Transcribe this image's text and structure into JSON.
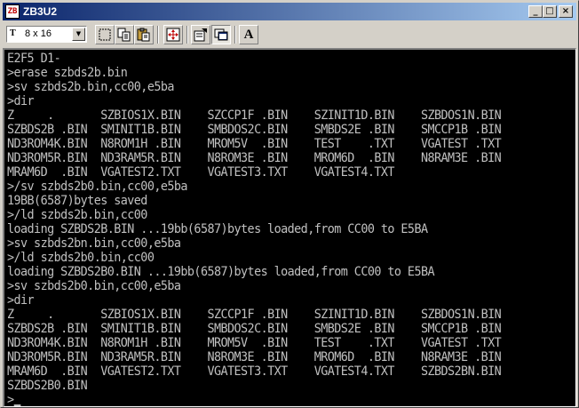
{
  "window": {
    "title": "ZB3U2",
    "icon_text": "ZB",
    "controls": {
      "minimize": "_",
      "maximize": "□",
      "close": "×"
    }
  },
  "toolbar": {
    "font_icon": "T",
    "font_size": "8 x 16",
    "buttons": [
      {
        "name": "select-icon"
      },
      {
        "name": "copy-icon"
      },
      {
        "name": "paste-icon"
      },
      {
        "name": "fullscreen-icon"
      },
      {
        "name": "properties-icon"
      },
      {
        "name": "background-icon"
      },
      {
        "name": "font-icon",
        "label": "A"
      }
    ]
  },
  "console": {
    "lines": [
      "E2F5 D1-",
      ">erase szbds2b.bin",
      ">sv szbds2b.bin,cc00,e5ba",
      ">dir",
      "Z     .       SZBIOS1X.BIN    SZCCP1F .BIN    SZINIT1D.BIN    SZBDOS1N.BIN",
      "SZBDS2B .BIN  SMINIT1B.BIN    SMBDOS2C.BIN    SMBDS2E .BIN    SMCCP1B .BIN",
      "ND3ROM4K.BIN  N8ROM1H .BIN    MROM5V  .BIN    TEST    .TXT    VGATEST .TXT",
      "ND3ROM5R.BIN  ND3RAM5R.BIN    N8ROM3E .BIN    MROM6D  .BIN    N8RAM3E .BIN",
      "MRAM6D  .BIN  VGATEST2.TXT    VGATEST3.TXT    VGATEST4.TXT",
      ">/sv szbds2b0.bin,cc00,e5ba",
      "19BB(6587)bytes saved",
      ">/ld szbds2b.bin,cc00",
      "loading SZBDS2B.BIN ...19bb(6587)bytes loaded,from CC00 to E5BA",
      ">sv szbds2bn.bin,cc00,e5ba",
      ">/ld szbds2b0.bin,cc00",
      "loading SZBDS2B0.BIN ...19bb(6587)bytes loaded,from CC00 to E5BA",
      ">sv szbds2b0.bin,cc00,e5ba",
      ">dir",
      "Z     .       SZBIOS1X.BIN    SZCCP1F .BIN    SZINIT1D.BIN    SZBDOS1N.BIN",
      "SZBDS2B .BIN  SMINIT1B.BIN    SMBDOS2C.BIN    SMBDS2E .BIN    SMCCP1B .BIN",
      "ND3ROM4K.BIN  N8ROM1H .BIN    MROM5V  .BIN    TEST    .TXT    VGATEST .TXT",
      "ND3ROM5R.BIN  ND3RAM5R.BIN    N8ROM3E .BIN    MROM6D  .BIN    N8RAM3E .BIN",
      "MRAM6D  .BIN  VGATEST2.TXT    VGATEST3.TXT    VGATEST4.TXT    SZBDS2BN.BIN",
      "SZBDS2B0.BIN"
    ],
    "prompt": ">",
    "colors": {
      "background": "#000000",
      "foreground": "#c0c0c0"
    }
  },
  "colors": {
    "titlebar_start": "#0a246a",
    "titlebar_end": "#a6caf0",
    "chrome": "#d4d0c8"
  }
}
